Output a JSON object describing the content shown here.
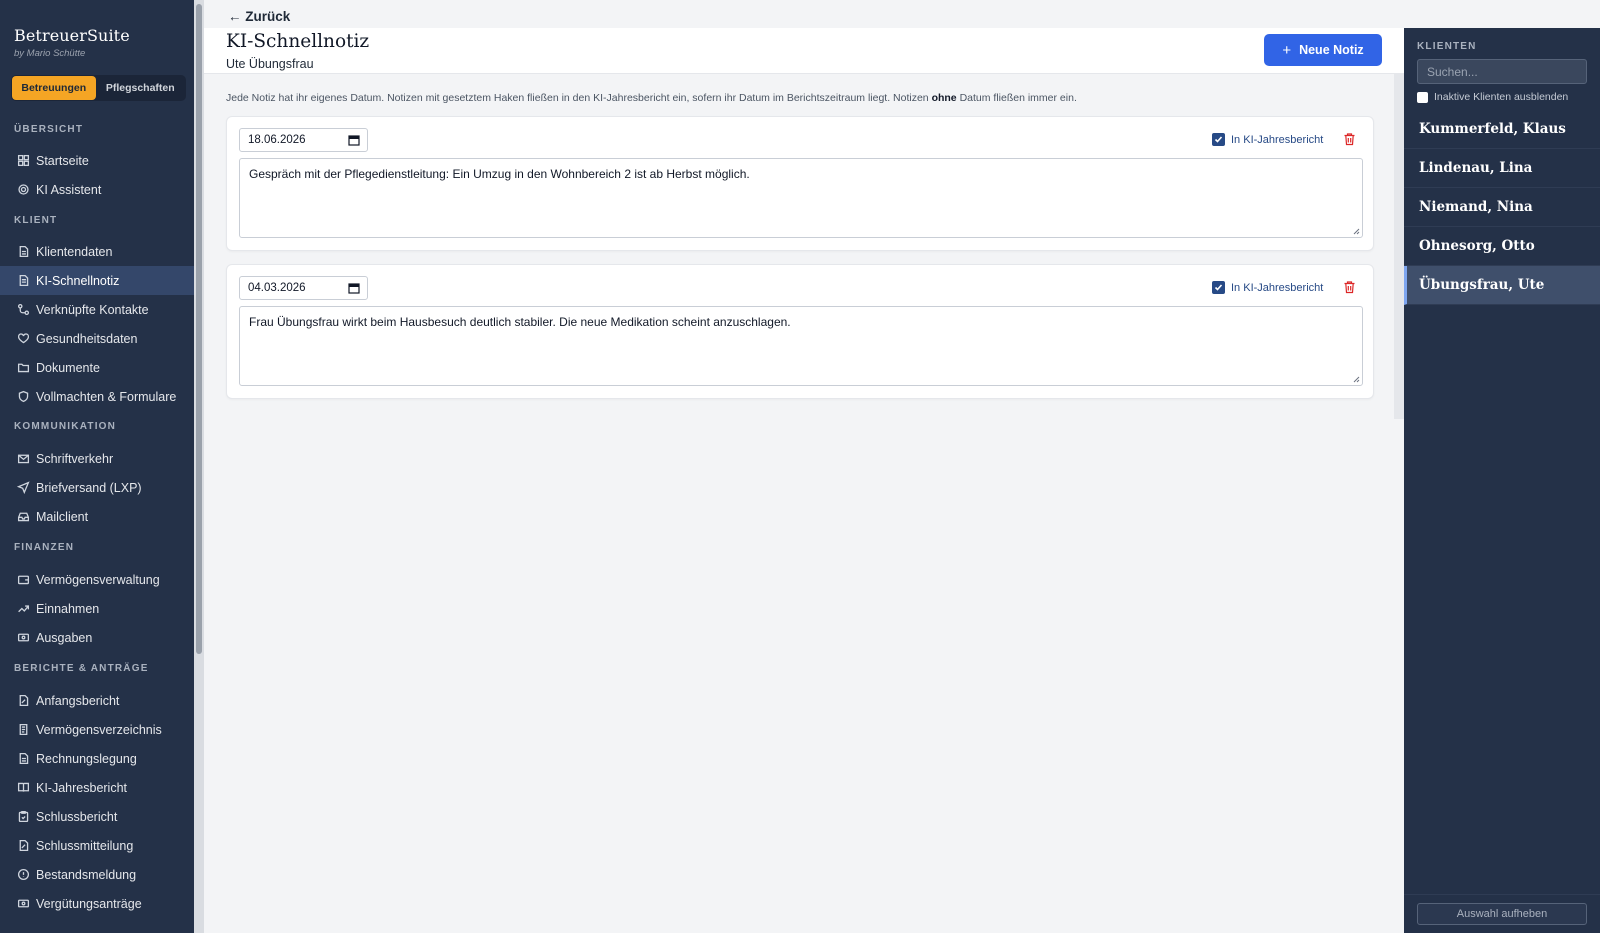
{
  "sidebar": {
    "brand_title": "BetreuerSuite",
    "brand_sub": "by Mario Schütte",
    "mode_active": "Betreuungen",
    "mode_inactive": "Pflegschaften",
    "sections": {
      "overview": "ÜBERSICHT",
      "client": "KLIENT",
      "communication": "KOMMUNIKATION",
      "finance": "FINANZEN",
      "reports": "BERICHTE & ANTRÄGE"
    },
    "items": [
      {
        "label": "Startseite",
        "icon": "dashboard-icon"
      },
      {
        "label": "KI Assistent",
        "icon": "gear-icon"
      },
      {
        "label": "Klientendaten",
        "icon": "document-icon"
      },
      {
        "label": "KI-Schnellnotiz",
        "icon": "note-icon",
        "active": true
      },
      {
        "label": "Verknüpfte Kontakte",
        "icon": "route-icon"
      },
      {
        "label": "Gesundheitsdaten",
        "icon": "heart-icon"
      },
      {
        "label": "Dokumente",
        "icon": "folder-icon"
      },
      {
        "label": "Vollmachten & Formulare",
        "icon": "shield-icon"
      },
      {
        "label": "Schriftverkehr",
        "icon": "mail-icon"
      },
      {
        "label": "Briefversand (LXP)",
        "icon": "send-icon"
      },
      {
        "label": "Mailclient",
        "icon": "inbox-icon"
      },
      {
        "label": "Vermögensverwaltung",
        "icon": "wallet-icon"
      },
      {
        "label": "Einnahmen",
        "icon": "trending-up-icon"
      },
      {
        "label": "Ausgaben",
        "icon": "banknote-icon"
      },
      {
        "label": "Anfangsbericht",
        "icon": "file-edit-icon"
      },
      {
        "label": "Vermögensverzeichnis",
        "icon": "scroll-icon"
      },
      {
        "label": "Rechnungslegung",
        "icon": "calculator-icon"
      },
      {
        "label": "KI-Jahresbericht",
        "icon": "book-icon"
      },
      {
        "label": "Schlussbericht",
        "icon": "clipboard-icon"
      },
      {
        "label": "Schlussmitteilung",
        "icon": "file-pen-icon"
      },
      {
        "label": "Bestandsmeldung",
        "icon": "alert-circle-icon"
      },
      {
        "label": "Vergütungsanträge",
        "icon": "banknote-icon"
      }
    ]
  },
  "main": {
    "back_label": "← Zurück",
    "title": "KI-Schnellnotiz",
    "subtitle": "Ute Übungsfrau",
    "new_button": "Neue Notiz",
    "info_before": "Jede Notiz hat ihr eigenes Datum. Notizen mit gesetztem Haken fließen in den KI-Jahresbericht ein, sofern ihr Datum im Berichtszeitraum liegt. Notizen ",
    "info_bold": "ohne",
    "info_after": " Datum fließen immer ein.",
    "notes": [
      {
        "date": "18.06.2026",
        "flag_label": "In KI-Jahresbericht",
        "flag_checked": true,
        "text": "Gespräch mit der Pflegedienstleitung: Ein Umzug in den Wohnbereich 2 ist ab Herbst möglich."
      },
      {
        "date": "04.03.2026",
        "flag_label": "In KI-Jahresbericht",
        "flag_checked": true,
        "text": "Frau Übungsfrau wirkt beim Hausbesuch deutlich stabiler. Die neue Medikation scheint anzuschlagen."
      }
    ]
  },
  "clients_panel": {
    "heading": "KLIENTEN",
    "search_placeholder": "Suchen...",
    "hide_inactive_label": "Inaktive Klienten ausblenden",
    "clients": [
      {
        "name": "Kummerfeld, Klaus"
      },
      {
        "name": "Lindenau, Lina"
      },
      {
        "name": "Niemand, Nina"
      },
      {
        "name": "Ohnesorg, Otto"
      },
      {
        "name": "Übungsfrau, Ute",
        "active": true
      }
    ],
    "clear_button": "Auswahl aufheben"
  },
  "colors": {
    "sidebar_bg": "#243148",
    "accent_orange": "#f5a524",
    "primary_blue": "#3164e6",
    "delete_red": "#dc2626"
  }
}
